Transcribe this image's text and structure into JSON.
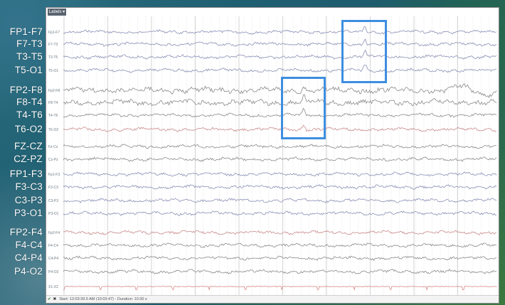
{
  "channels": [
    {
      "label": "FP1-F7",
      "group": 1,
      "color": "#8a8fb4"
    },
    {
      "label": "F7-T3",
      "group": 1,
      "color": "#8a8fb4"
    },
    {
      "label": "T3-T5",
      "group": 1,
      "color": "#8a8fb4"
    },
    {
      "label": "T5-O1",
      "group": 1,
      "color": "#8a8fb4"
    },
    {
      "label": "FP2-F8",
      "group": 2,
      "color": "#8a8a8a"
    },
    {
      "label": "F8-T4",
      "group": 2,
      "color": "#8a8a8a"
    },
    {
      "label": "T4-T6",
      "group": 2,
      "color": "#8a8a8a"
    },
    {
      "label": "T6-O2",
      "group": 2,
      "color": "#c98a8a"
    },
    {
      "label": "FZ-CZ",
      "group": 3,
      "color": "#8a8a8a"
    },
    {
      "label": "CZ-PZ",
      "group": 3,
      "color": "#8a8a8a"
    },
    {
      "label": "FP1-F3",
      "group": 4,
      "color": "#8a8fb4"
    },
    {
      "label": "F3-C3",
      "group": 4,
      "color": "#8a8fb4"
    },
    {
      "label": "C3-P3",
      "group": 4,
      "color": "#8a8fb4"
    },
    {
      "label": "P3-O1",
      "group": 4,
      "color": "#8a8fb4"
    },
    {
      "label": "FP2-F4",
      "group": 5,
      "color": "#c98a8a"
    },
    {
      "label": "F4-C4",
      "group": 5,
      "color": "#8a8a8a"
    },
    {
      "label": "C4-P4",
      "group": 5,
      "color": "#8a8a8a"
    },
    {
      "label": "P4-O2",
      "group": 5,
      "color": "#8a8a8a"
    }
  ],
  "window": {
    "labels_tab": "Labels ▾",
    "status_text": "Start: 12:03:39.5 AM (10:03:47) - Duration: 10.00 s",
    "confirm_icon": "check-icon",
    "cancel_icon": "close-icon"
  },
  "colors": {
    "highlight": "#3d8ee0",
    "ecg_trace": "#d98a8a"
  }
}
